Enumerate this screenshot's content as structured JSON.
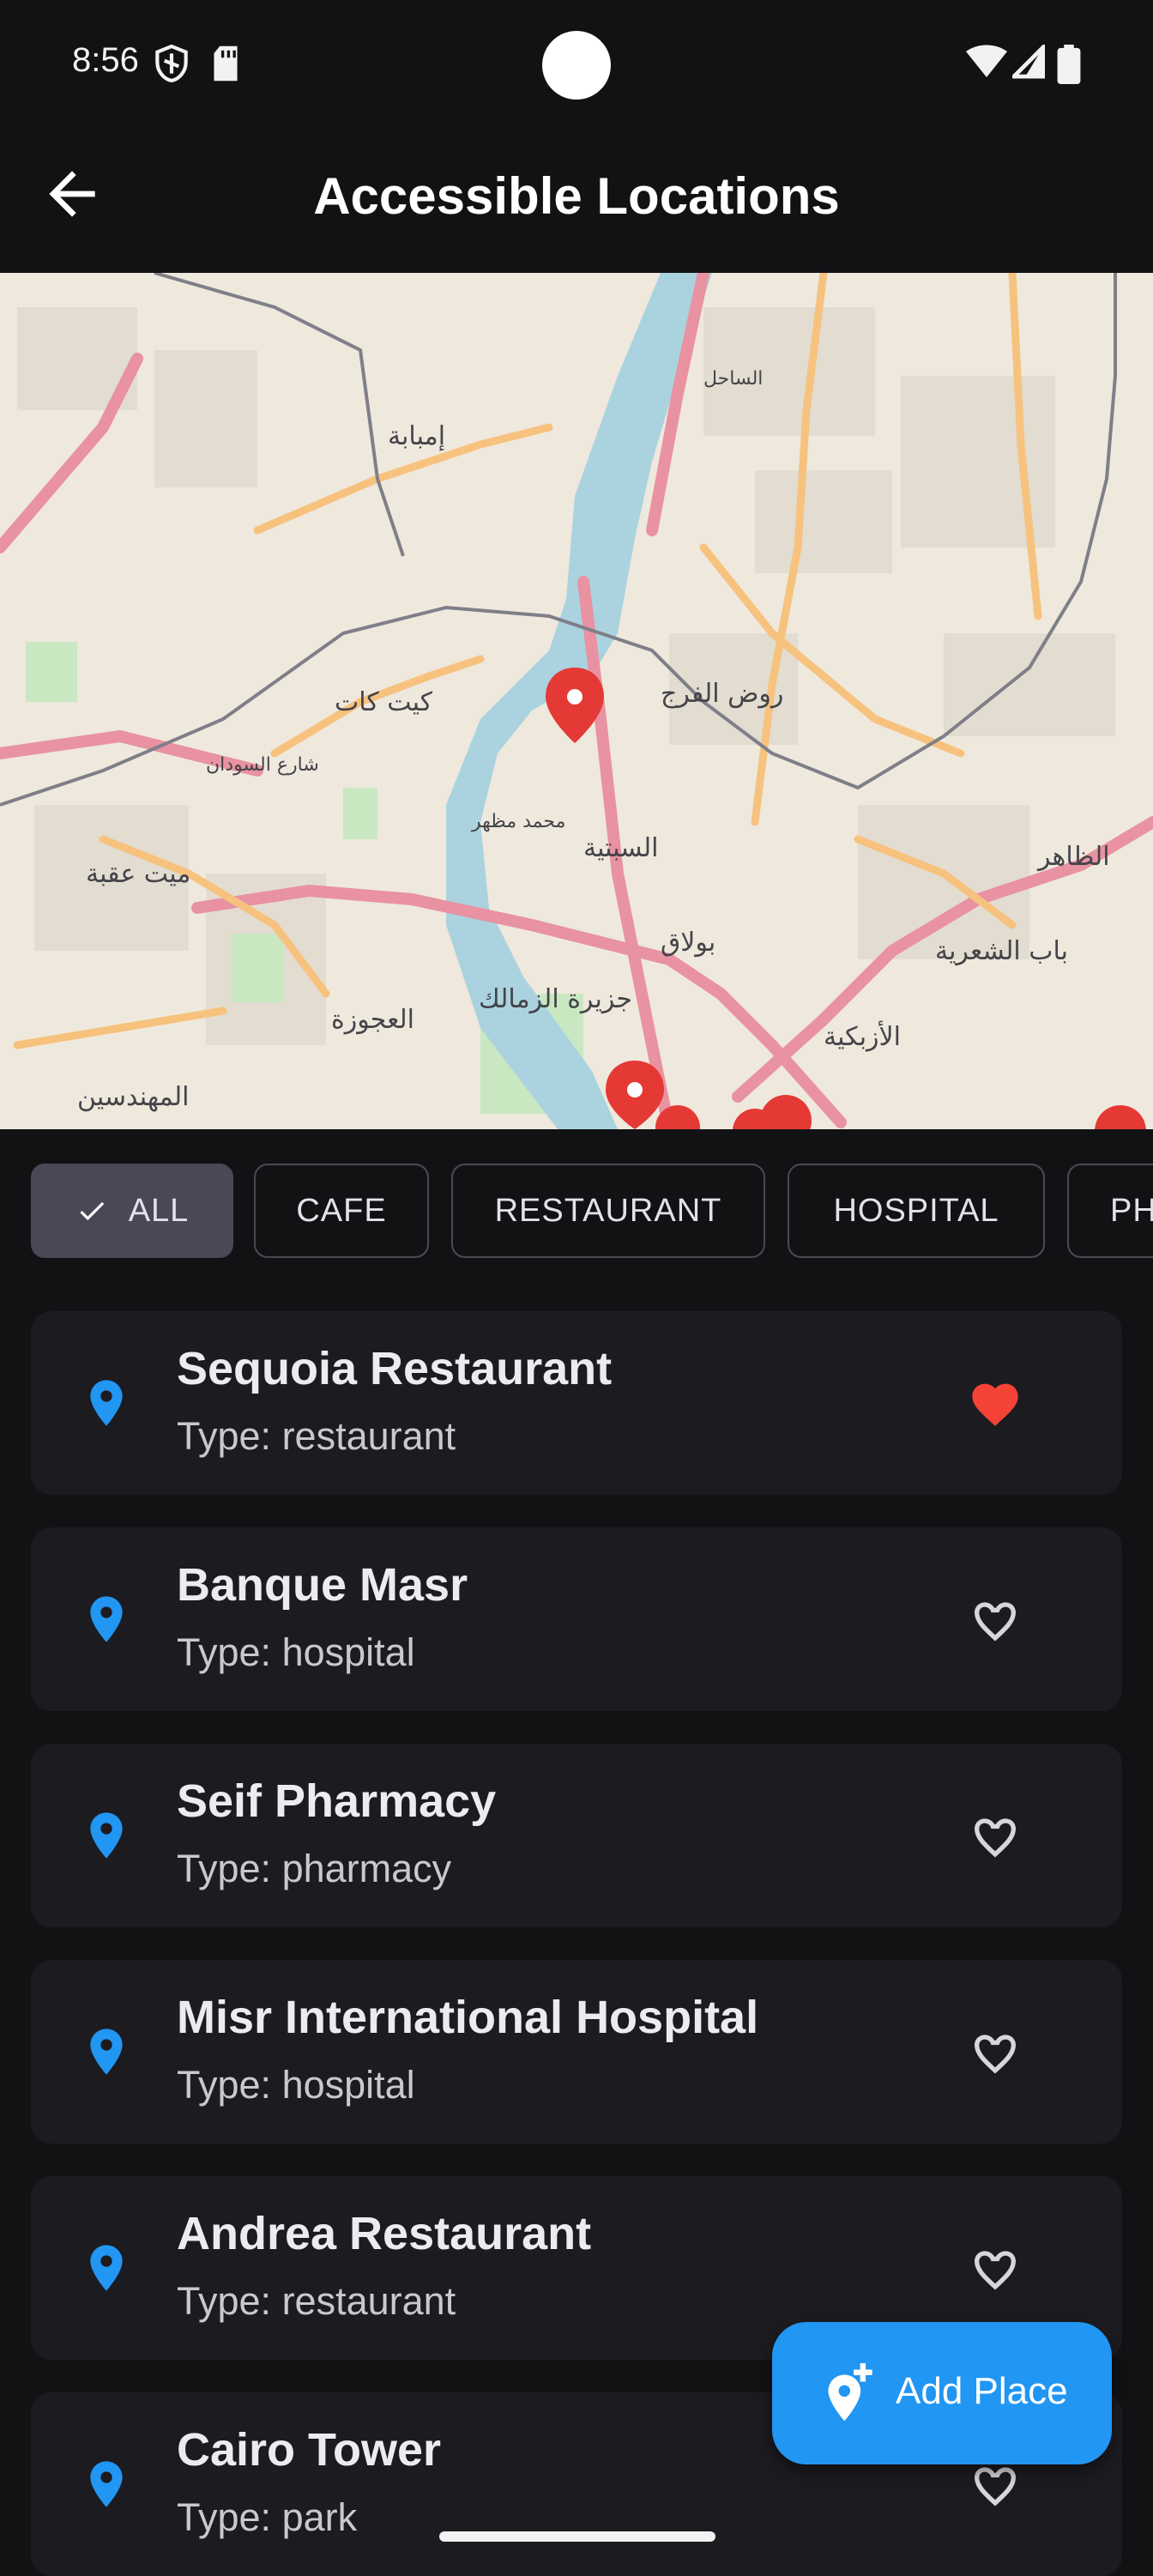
{
  "status_bar": {
    "time": "8:56",
    "left_icons": [
      "shield-icon",
      "sd-card-icon"
    ],
    "right_icons": [
      "wifi-icon",
      "signal-icon",
      "battery-icon"
    ]
  },
  "app_bar": {
    "title": "Accessible Locations",
    "back_icon": "arrow-back-icon"
  },
  "map": {
    "labels": [
      "إمبابة",
      "كيت كات",
      "روض الفرج",
      "السبتية",
      "بولاق",
      "ميت عقبة",
      "العجوزة",
      "جزيرة الزمالك",
      "المهندسين",
      "الأزبكية",
      "باب الشعرية",
      "الظاهر",
      "شارع السودان",
      "محمد مظهر",
      "الساحل"
    ],
    "marker_color": "#e53935"
  },
  "filters": {
    "chips": [
      {
        "label": "ALL",
        "selected": true
      },
      {
        "label": "CAFE",
        "selected": false
      },
      {
        "label": "RESTAURANT",
        "selected": false
      },
      {
        "label": "HOSPITAL",
        "selected": false
      },
      {
        "label": "PH",
        "selected": false
      }
    ]
  },
  "places": [
    {
      "name": "Sequoia Restaurant",
      "type": "Type: restaurant",
      "favorite": true
    },
    {
      "name": "Banque Masr",
      "type": "Type: hospital",
      "favorite": false
    },
    {
      "name": "Seif Pharmacy",
      "type": "Type: pharmacy",
      "favorite": false
    },
    {
      "name": "Misr International Hospital",
      "type": "Type: hospital",
      "favorite": false
    },
    {
      "name": "Andrea Restaurant",
      "type": "Type: restaurant",
      "favorite": false
    },
    {
      "name": "Cairo Tower",
      "type": "Type: park",
      "favorite": false
    }
  ],
  "fab": {
    "label": "Add Place",
    "icon": "add-location-icon"
  },
  "colors": {
    "background": "#121214",
    "card": "#1c1b20",
    "accent": "#2196f3",
    "favorite": "#f44336",
    "chip_selected": "#4a4857"
  }
}
